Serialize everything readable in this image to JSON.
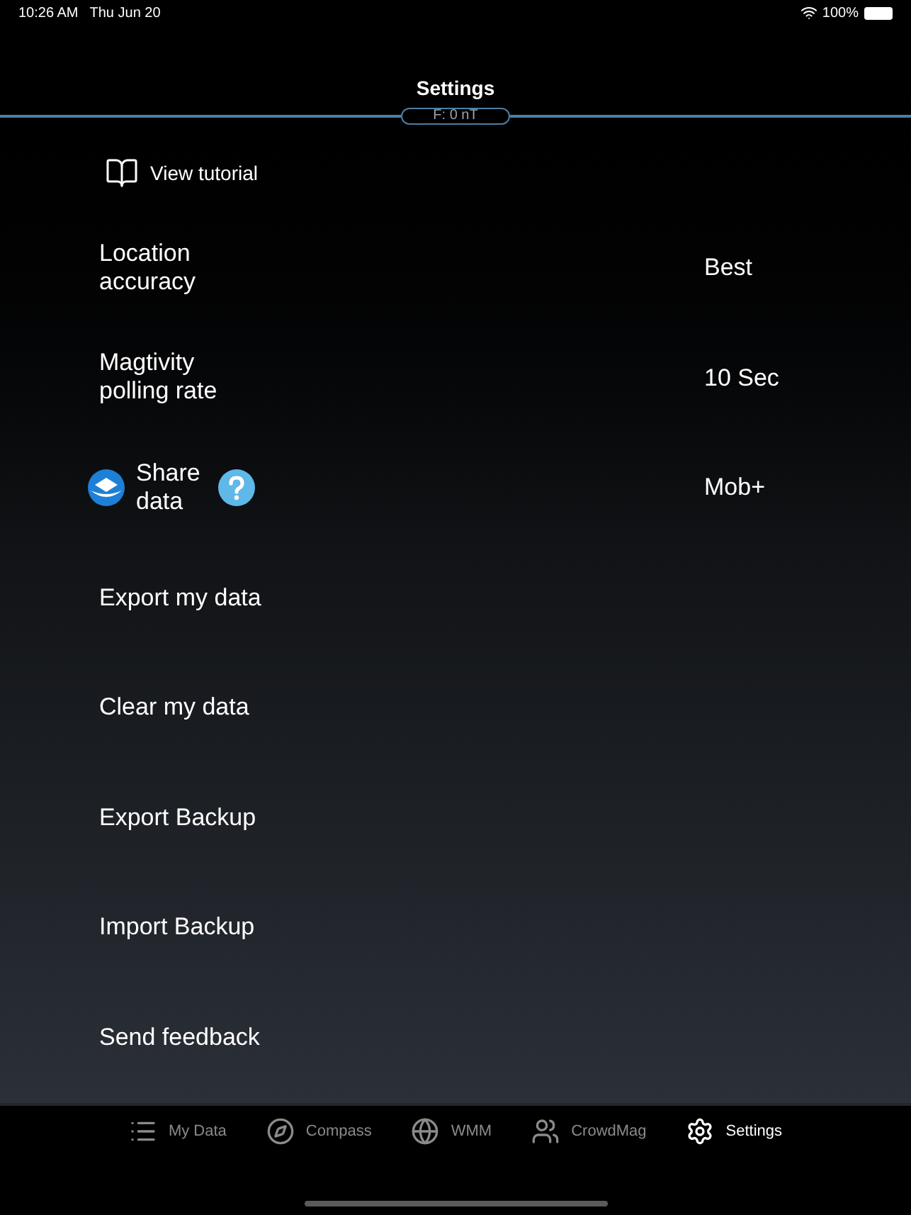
{
  "status_bar": {
    "time": "10:26 AM",
    "date": "Thu Jun 20",
    "battery": "100%"
  },
  "header": {
    "title": "Settings",
    "field_reading": "F: 0 nT"
  },
  "rows": [
    {
      "kind": "tutorial",
      "label": "View tutorial"
    },
    {
      "kind": "setting",
      "label": "Location accuracy",
      "value": "Best"
    },
    {
      "kind": "setting",
      "label": "Magtivity polling rate",
      "value": "10 Sec"
    },
    {
      "kind": "share",
      "label": "Share data",
      "value": "Mob+"
    },
    {
      "kind": "action",
      "label": "Export my data"
    },
    {
      "kind": "action",
      "label": "Clear my data"
    },
    {
      "kind": "action",
      "label": "Export Backup"
    },
    {
      "kind": "action",
      "label": "Import Backup"
    },
    {
      "kind": "action",
      "label": "Send feedback"
    }
  ],
  "tabs": [
    {
      "label": "My Data",
      "selected": false
    },
    {
      "label": "Compass",
      "selected": false
    },
    {
      "label": "WMM",
      "selected": false
    },
    {
      "label": "CrowdMag",
      "selected": false
    },
    {
      "label": "Settings",
      "selected": true
    }
  ]
}
